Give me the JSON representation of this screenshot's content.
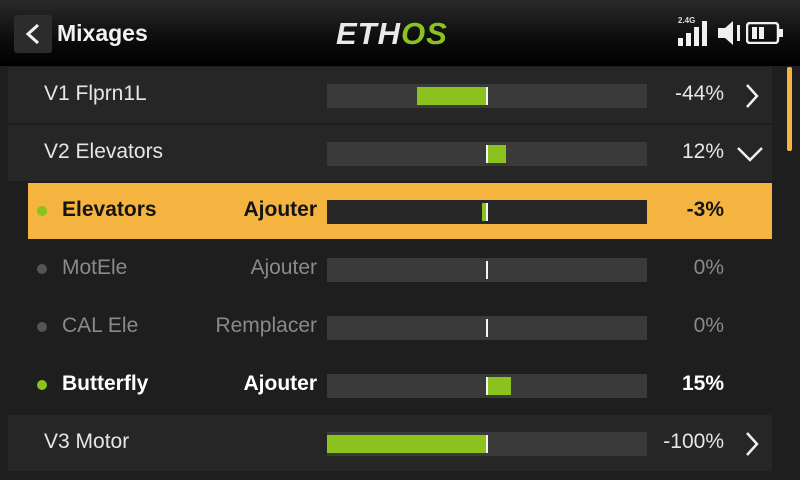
{
  "header": {
    "title": "Mixages",
    "logo_left": "ETH",
    "logo_right": "OS",
    "signal_label": "2.4G",
    "back_icon": "chevron-left-icon",
    "signal_icon": "signal-bars-icon",
    "audio_icon": "speaker-icon",
    "battery_icon": "battery-icon"
  },
  "colors": {
    "accent_green": "#8bc21d",
    "selected_row": "#f5b440",
    "background": "#1e1e1e"
  },
  "mixes": [
    {
      "label": "V1 Flprn1L",
      "value": "-44%",
      "level": -44,
      "chevron": "chevron-right-icon"
    },
    {
      "label": "V2 Elevators",
      "value": "12%",
      "level": 12,
      "chevron": "chevron-down-icon"
    }
  ],
  "sublines": [
    {
      "label": "Elevators",
      "operation": "Ajouter",
      "value": "-3%",
      "level": -3,
      "active": true,
      "selected": true
    },
    {
      "label": "MotEle",
      "operation": "Ajouter",
      "value": "0%",
      "level": 0,
      "active": false,
      "selected": false
    },
    {
      "label": "CAL Ele",
      "operation": "Remplacer",
      "value": "0%",
      "level": 0,
      "active": false,
      "selected": false
    },
    {
      "label": "Butterfly",
      "operation": "Ajouter",
      "value": "15%",
      "level": 15,
      "active": true,
      "selected": false
    }
  ],
  "mix_last": {
    "label": "V3 Motor",
    "value": "-100%",
    "level": -100,
    "chevron": "chevron-right-icon"
  }
}
